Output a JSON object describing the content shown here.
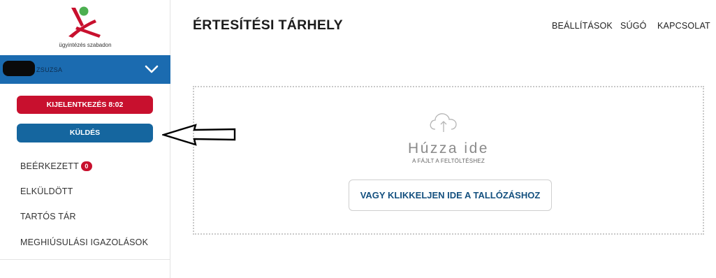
{
  "brand": {
    "tagline": "ügyintézés szabadon",
    "icon": "logo-icon",
    "colors": {
      "red": "#c8102e",
      "green": "#4caf50"
    }
  },
  "user": {
    "name_visible": "ZSUZSA",
    "expand_icon": "chevron-down-icon"
  },
  "sidebar": {
    "logout_label": "KIJELENTKEZÉS 8:02",
    "send_label": "KÜLDÉS",
    "items": [
      {
        "label": "BEÉRKEZETT",
        "badge": "0"
      },
      {
        "label": "ELKÜLDÖTT"
      },
      {
        "label": "TARTÓS TÁR"
      },
      {
        "label": "MEGHIÚSULÁSI IGAZOLÁSOK"
      }
    ]
  },
  "header": {
    "title": "ÉRTESÍTÉSI TÁRHELY",
    "nav": [
      "BEÁLLÍTÁSOK",
      "SÚGÓ",
      "KAPCSOLAT"
    ]
  },
  "upload": {
    "icon": "cloud-upload-icon",
    "drop_main": "Húzza ide",
    "drop_sub": "A FÁJLT A FELTÖLTÉSHEZ",
    "browse_label": "VAGY KLIKKELJEN IDE A TALLÓZÁSHOZ"
  },
  "colors": {
    "accent_blue": "#1b6bb0",
    "button_blue": "#15669f",
    "button_red": "#c8102e"
  }
}
